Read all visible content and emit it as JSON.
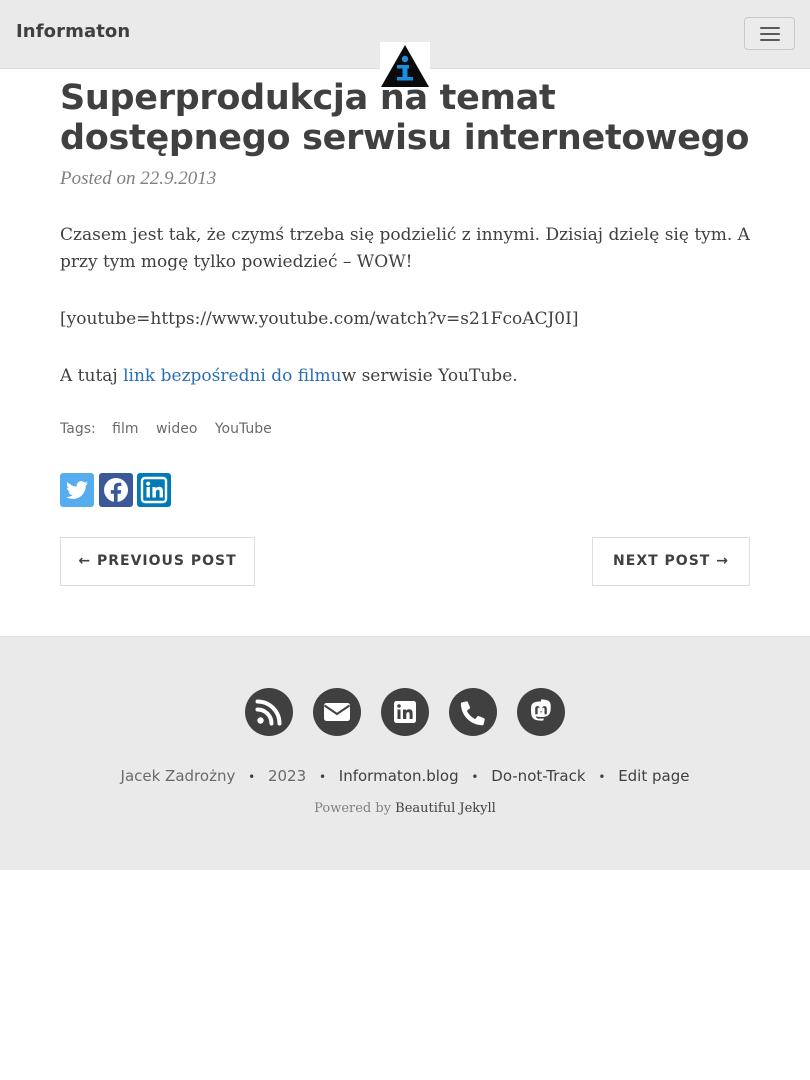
{
  "nav": {
    "brand": "Informaton",
    "menu_icon": "hamburger-menu-icon",
    "logo_icon": "informaton-info-logo"
  },
  "post": {
    "title": "Superprodukcja na temat dostępnego serwisu internetowego",
    "meta": "Posted on 22.9.2013",
    "p1": "Czasem jest tak, że czymś trzeba się podzielić z innymi. Dzisiaj dzielę się tym. A przy tym mogę tylko powiedzieć – WOW!",
    "p2": "[youtube=https://www.youtube.com/watch?v=s21FcoACJ0I]",
    "p3_before": "A tutaj ",
    "p3_link": "link bezpośredni do filmu",
    "p3_after": "w serwisie YouTube.",
    "tags_label": "Tags:",
    "tags": [
      "film",
      "wideo",
      "YouTube"
    ]
  },
  "share": [
    {
      "icon": "twitter-icon",
      "color": "#55acee"
    },
    {
      "icon": "facebook-icon",
      "color": "#3b5998"
    },
    {
      "icon": "linkedin-icon",
      "color": "#007bb5"
    }
  ],
  "pager": {
    "previous": "← PREVIOUS POST",
    "next": "NEXT POST →"
  },
  "footer": {
    "social_icons": [
      "rss-icon",
      "envelope-icon",
      "linkedin-icon",
      "phone-icon",
      "mastodon-icon"
    ],
    "author": "Jacek Zadrożny",
    "year": "2023",
    "site": "Informaton.blog",
    "dnt": "Do-not-Track",
    "edit": "Edit page",
    "powered_prefix": "Powered by ",
    "powered_link": "Beautiful Jekyll",
    "separator": "•"
  },
  "colors": {
    "navbar_bg": "#eaeaea",
    "text": "#404040",
    "link": "#2a6fb5",
    "footer_bg": "#eaeaea"
  }
}
